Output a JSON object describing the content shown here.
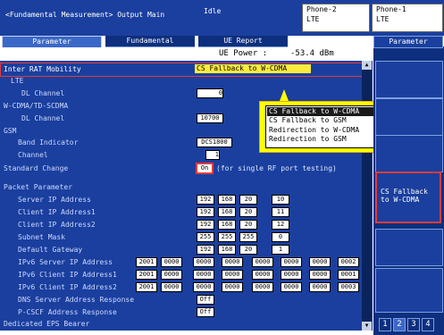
{
  "header": {
    "title": "<Fundamental Measurement> Output Main",
    "status": "Idle",
    "phone2": {
      "line1": "Phone-2",
      "line2": "LTE"
    },
    "phone1": {
      "line1": "Phone-1",
      "line2": "LTE"
    }
  },
  "tabs": [
    "Parameter",
    "Fundamental",
    "UE Report"
  ],
  "right_tab": "Parameter",
  "ue_power": {
    "label": "UE Power :",
    "value": "-53.4 dBm"
  },
  "params": {
    "irat_label": "Inter RAT Mobility",
    "irat_value": "CS Fallback to W-CDMA",
    "lte": "LTE",
    "dl_channel_lte_label": "DL Channel",
    "dl_channel_lte_value": "0",
    "wcdma": "W-CDMA/TD-SCDMA",
    "dl_channel_wcdma_label": "DL Channel",
    "dl_channel_wcdma_value": "10700",
    "gsm": "GSM",
    "band_indicator_label": "Band Indicator",
    "band_indicator_value": "DCS1800",
    "channel_label": "Channel",
    "channel_value": "1",
    "standard_change_label": "Standard Change",
    "standard_change_value": "On",
    "standard_change_note": "(for single RF port testing)",
    "packet_param": "Packet Parameter",
    "server_ip_label": "Server IP Address",
    "server_ip": [
      "192",
      "168",
      "20",
      "10"
    ],
    "client_ip1_label": "Client IP Address1",
    "client_ip1": [
      "192",
      "168",
      "20",
      "11"
    ],
    "client_ip2_label": "Client IP Address2",
    "client_ip2": [
      "192",
      "168",
      "20",
      "12"
    ],
    "subnet_label": "Subnet Mask",
    "subnet": [
      "255",
      "255",
      "255",
      "0"
    ],
    "gateway_label": "Default Gateway",
    "gateway": [
      "192",
      "168",
      "20",
      "1"
    ],
    "ipv6_server_label": "IPv6 Server IP Address",
    "ipv6_server": [
      "2001",
      "0000",
      "0000",
      "0000",
      "0000",
      "0000",
      "0000",
      "0002"
    ],
    "ipv6_client1_label": "IPv6 Client IP Address1",
    "ipv6_client1": [
      "2001",
      "0000",
      "0000",
      "0000",
      "0000",
      "0000",
      "0000",
      "0001"
    ],
    "ipv6_client2_label": "IPv6 Client IP Address2",
    "ipv6_client2": [
      "2001",
      "0000",
      "0000",
      "0000",
      "0000",
      "0000",
      "0000",
      "0003"
    ],
    "dns_label": "DNS Server Address Response",
    "dns_value": "Off",
    "pcscf_label": "P-CSCF Address Response",
    "pcscf_value": "Off",
    "dedicated_eps": "Dedicated EPS Bearer"
  },
  "popup": {
    "options": [
      "CS Fallback to W-CDMA",
      "CS Fallback to GSM",
      "Redirection to W-CDMA",
      "Redirection to GSM"
    ],
    "selected_index": 0
  },
  "side_button": {
    "line1": "CS Fallback",
    "line2": "to W-CDMA"
  },
  "pages": [
    "1",
    "2",
    "3",
    "4"
  ]
}
